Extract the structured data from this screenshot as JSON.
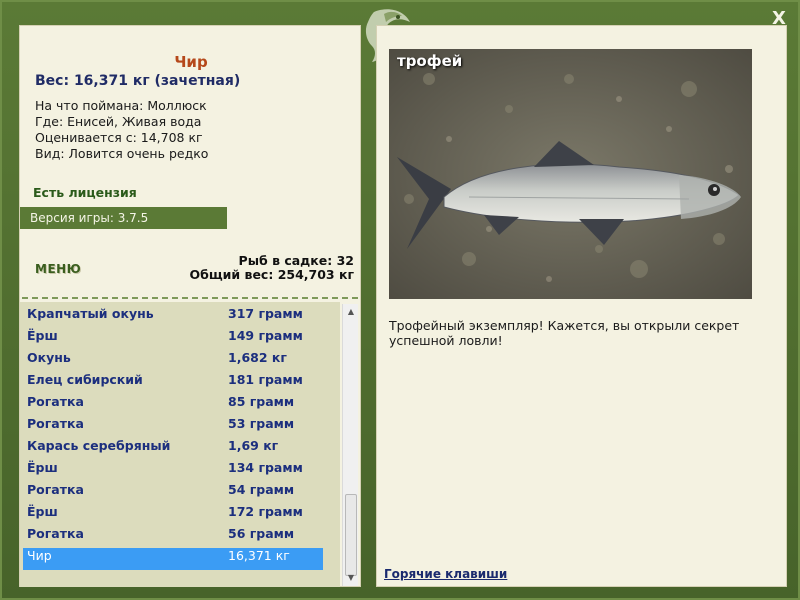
{
  "window": {
    "close_label": "X"
  },
  "fish": {
    "name": "Чир",
    "weight": "Вес: 16,371 кг (зачетная)",
    "info": [
      "На что поймана: Моллюск",
      "Где: Енисей, Живая вода",
      "Оценивается с: 14,708 кг",
      "Вид: Ловится очень редко"
    ]
  },
  "license": "Есть лицензия",
  "version": "Версия игры: 3.7.5",
  "menu_label": "МЕНЮ",
  "keep": {
    "count": "Рыб в садке: 32",
    "total": "Общий вес: 254,703 кг"
  },
  "catch_list": [
    {
      "name": "Крапчатый окунь",
      "weight": "317 грамм",
      "selected": false
    },
    {
      "name": "Ёрш",
      "weight": "149 грамм",
      "selected": false
    },
    {
      "name": "Окунь",
      "weight": "1,682 кг",
      "selected": false
    },
    {
      "name": "Елец сибирский",
      "weight": "181 грамм",
      "selected": false
    },
    {
      "name": "Рогатка",
      "weight": "85 грамм",
      "selected": false
    },
    {
      "name": "Рогатка",
      "weight": "53 грамм",
      "selected": false
    },
    {
      "name": "Карась серебряный",
      "weight": "1,69 кг",
      "selected": false
    },
    {
      "name": "Ёрш",
      "weight": "134 грамм",
      "selected": false
    },
    {
      "name": "Рогатка",
      "weight": "54 грамм",
      "selected": false
    },
    {
      "name": "Ёрш",
      "weight": "172 грамм",
      "selected": false
    },
    {
      "name": "Рогатка",
      "weight": "56 грамм",
      "selected": false
    },
    {
      "name": "Чир",
      "weight": "16,371 кг",
      "selected": true
    }
  ],
  "trophy": {
    "label": "трофей",
    "text": "Трофейный экземпляр! Кажется, вы открыли секрет успешной ловли!"
  },
  "hotkeys_label": "Горячие клавиши",
  "colors": {
    "frame_green": "#5b7a36",
    "panel_bg": "#f4f2e1",
    "list_text": "#1c2f7e",
    "selected_row": "#3b9cf4",
    "fish_name": "#b5481a"
  }
}
